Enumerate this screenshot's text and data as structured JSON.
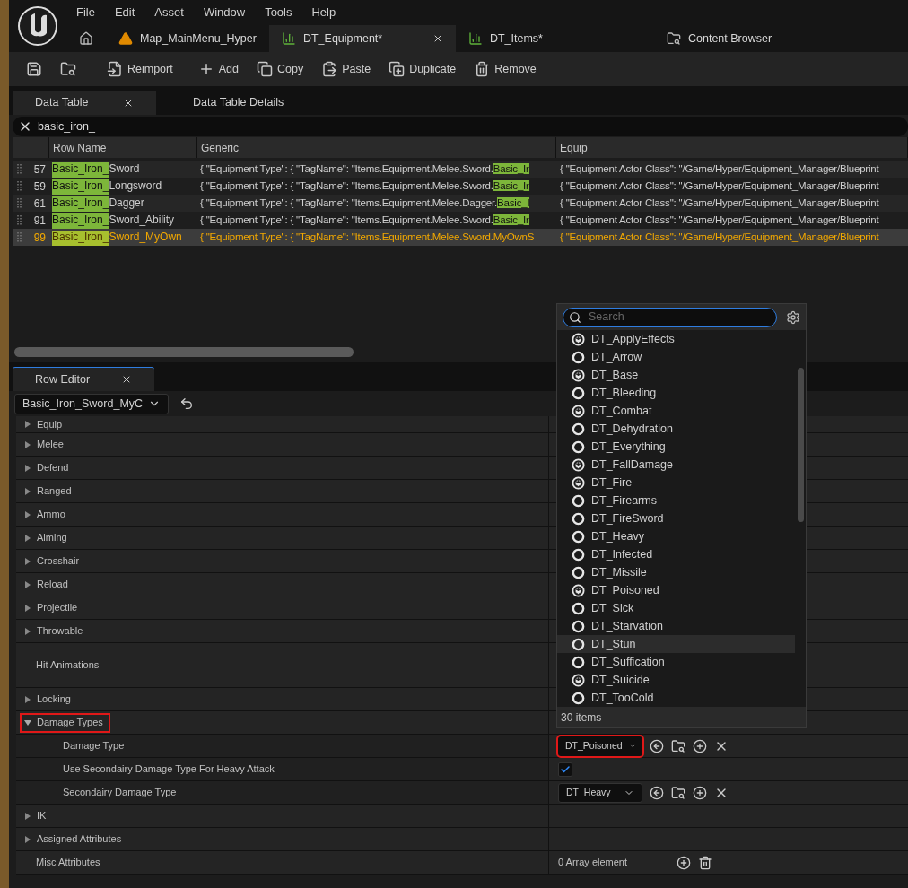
{
  "menu": [
    "File",
    "Edit",
    "Asset",
    "Window",
    "Tools",
    "Help"
  ],
  "doc_tabs": [
    {
      "kind": "home",
      "selected": false,
      "closable": false
    },
    {
      "kind": "map",
      "label": "Map_MainMenu_Hyper",
      "selected": false,
      "closable": false
    },
    {
      "kind": "table",
      "label": "DT_Equipment*",
      "selected": true,
      "closable": true
    },
    {
      "kind": "table",
      "label": "DT_Items*",
      "selected": false,
      "closable": false
    },
    {
      "kind": "browser",
      "label": "Content Browser",
      "selected": false,
      "closable": false
    }
  ],
  "toolbar": [
    {
      "kind": "save"
    },
    {
      "kind": "browse"
    },
    {
      "kind": "reimport",
      "label": "Reimport"
    },
    {
      "kind": "add",
      "label": "Add"
    },
    {
      "kind": "copy",
      "label": "Copy"
    },
    {
      "kind": "paste",
      "label": "Paste"
    },
    {
      "kind": "duplicate",
      "label": "Duplicate"
    },
    {
      "kind": "remove",
      "label": "Remove"
    }
  ],
  "panel_tabs": [
    {
      "label": "Data Table",
      "selected": true,
      "closable": true
    },
    {
      "label": "Data Table Details",
      "selected": false,
      "closable": false
    }
  ],
  "search": {
    "value": "basic_iron_"
  },
  "table": {
    "columns": [
      "Row Name",
      "Generic",
      "Equip"
    ],
    "rows": [
      {
        "number": "57",
        "name_match": "Basic_Iron_",
        "name_rest": "Sword",
        "generic": "{ \"Equipment Type\": { \"TagName\": \"Items.Equipment.Melee.Sword.",
        "generic_match": "Basic_Ir",
        "equip": "{ \"Equipment Actor Class\": \"/Game/Hyper/Equipment_Manager/Blueprint",
        "selected": false
      },
      {
        "number": "59",
        "name_match": "Basic_Iron_",
        "name_rest": "Longsword",
        "generic": "{ \"Equipment Type\": { \"TagName\": \"Items.Equipment.Melee.Sword.",
        "generic_match": "Basic_Ir",
        "equip": "{ \"Equipment Actor Class\": \"/Game/Hyper/Equipment_Manager/Blueprint",
        "selected": false
      },
      {
        "number": "61",
        "name_match": "Basic_Iron_",
        "name_rest": "Dagger",
        "generic": "{ \"Equipment Type\": { \"TagName\": \"Items.Equipment.Melee.Dagger.",
        "generic_match": "Basic_I",
        "equip": "{ \"Equipment Actor Class\": \"/Game/Hyper/Equipment_Manager/Blueprint",
        "selected": false
      },
      {
        "number": "91",
        "name_match": "Basic_Iron_",
        "name_rest": "Sword_Ability",
        "generic": "{ \"Equipment Type\": { \"TagName\": \"Items.Equipment.Melee.Sword.",
        "generic_match": "Basic_Ir",
        "equip": "{ \"Equipment Actor Class\": \"/Game/Hyper/Equipment_Manager/Blueprint",
        "selected": false
      },
      {
        "number": "99",
        "name_match": "Basic_Iron_",
        "name_rest": "Sword_MyOwn",
        "generic": "{ \"Equipment Type\": { \"TagName\": \"Items.Equipment.Melee.Sword.MyOwnS",
        "equip": "{ \"Equipment Actor Class\": \"/Game/Hyper/Equipment_Manager/Blueprint",
        "selected": true
      }
    ]
  },
  "row_editor": {
    "tab": {
      "label": "Row Editor",
      "closable": true
    },
    "row_select": "Basic_Iron_Sword_MyC",
    "properties": [
      {
        "kind": "category",
        "label": "Equip",
        "expanded": false
      },
      {
        "kind": "category",
        "label": "Melee",
        "expanded": false
      },
      {
        "kind": "category",
        "label": "Defend",
        "expanded": false
      },
      {
        "kind": "category",
        "label": "Ranged",
        "expanded": false
      },
      {
        "kind": "category",
        "label": "Ammo",
        "expanded": false
      },
      {
        "kind": "category",
        "label": "Aiming",
        "expanded": false
      },
      {
        "kind": "category",
        "label": "Crosshair",
        "expanded": false
      },
      {
        "kind": "category",
        "label": "Reload",
        "expanded": false
      },
      {
        "kind": "category",
        "label": "Projectile",
        "expanded": false
      },
      {
        "kind": "category",
        "label": "Throwable",
        "expanded": false
      },
      {
        "kind": "plain",
        "label": "Hit Animations"
      },
      {
        "kind": "category",
        "label": "Locking",
        "expanded": false
      },
      {
        "kind": "category",
        "label": "Damage Types",
        "expanded": true,
        "annotated": true,
        "children": [
          {
            "kind": "combo",
            "label": "Damage Type",
            "value": "DT_Poisoned",
            "annotated": true
          },
          {
            "kind": "checkbox",
            "label": "Use Secondairy Damage Type For Heavy Attack",
            "checked": true
          },
          {
            "kind": "combo",
            "label": "Secondairy Damage Type",
            "value": "DT_Heavy",
            "annotated": false
          }
        ]
      },
      {
        "kind": "category",
        "label": "IK",
        "expanded": false
      },
      {
        "kind": "category",
        "label": "Assigned Attributes",
        "expanded": false
      },
      {
        "kind": "array",
        "label": "Misc Attributes",
        "value": "0 Array element"
      }
    ]
  },
  "picker": {
    "search_placeholder": "Search",
    "count": "30 items",
    "items": [
      {
        "label": "DT_ApplyEffects",
        "kind": "cube",
        "selected": false
      },
      {
        "label": "DT_Arrow",
        "kind": "ring",
        "selected": false
      },
      {
        "label": "DT_Base",
        "kind": "cube",
        "selected": false
      },
      {
        "label": "DT_Bleeding",
        "kind": "ring",
        "selected": false
      },
      {
        "label": "DT_Combat",
        "kind": "cube",
        "selected": false
      },
      {
        "label": "DT_Dehydration",
        "kind": "ring",
        "selected": false
      },
      {
        "label": "DT_Everything",
        "kind": "ring",
        "selected": false
      },
      {
        "label": "DT_FallDamage",
        "kind": "cube",
        "selected": false
      },
      {
        "label": "DT_Fire",
        "kind": "cube",
        "selected": false
      },
      {
        "label": "DT_Firearms",
        "kind": "ring",
        "selected": false
      },
      {
        "label": "DT_FireSword",
        "kind": "ring",
        "selected": false
      },
      {
        "label": "DT_Heavy",
        "kind": "ring",
        "selected": false
      },
      {
        "label": "DT_Infected",
        "kind": "ring",
        "selected": false
      },
      {
        "label": "DT_Missile",
        "kind": "ring",
        "selected": false
      },
      {
        "label": "DT_Poisoned",
        "kind": "cube",
        "selected": false
      },
      {
        "label": "DT_Sick",
        "kind": "ring",
        "selected": false
      },
      {
        "label": "DT_Starvation",
        "kind": "ring",
        "selected": false
      },
      {
        "label": "DT_Stun",
        "kind": "ring",
        "selected": true
      },
      {
        "label": "DT_Suffication",
        "kind": "ring",
        "selected": false
      },
      {
        "label": "DT_Suicide",
        "kind": "cube",
        "selected": false
      },
      {
        "label": "DT_TooCold",
        "kind": "ring",
        "selected": false
      }
    ]
  }
}
